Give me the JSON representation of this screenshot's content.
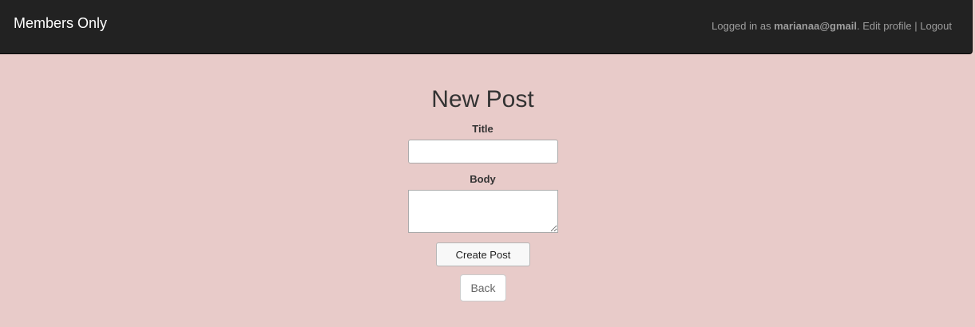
{
  "navbar": {
    "brand": "Members Only",
    "logged_in_prefix": "Logged in as ",
    "user_email": "marianaa@gmail",
    "separator_after_email": ". ",
    "edit_profile": "Edit profile",
    "divider": " | ",
    "logout": "Logout"
  },
  "page": {
    "heading": "New Post",
    "title_label": "Title",
    "title_value": "",
    "body_label": "Body",
    "body_value": "",
    "create_button": "Create Post",
    "back_button": "Back"
  },
  "colors": {
    "navbar_bg": "#222222",
    "page_bg": "#e8cbc9",
    "nav_text": "#9d9d9d"
  }
}
